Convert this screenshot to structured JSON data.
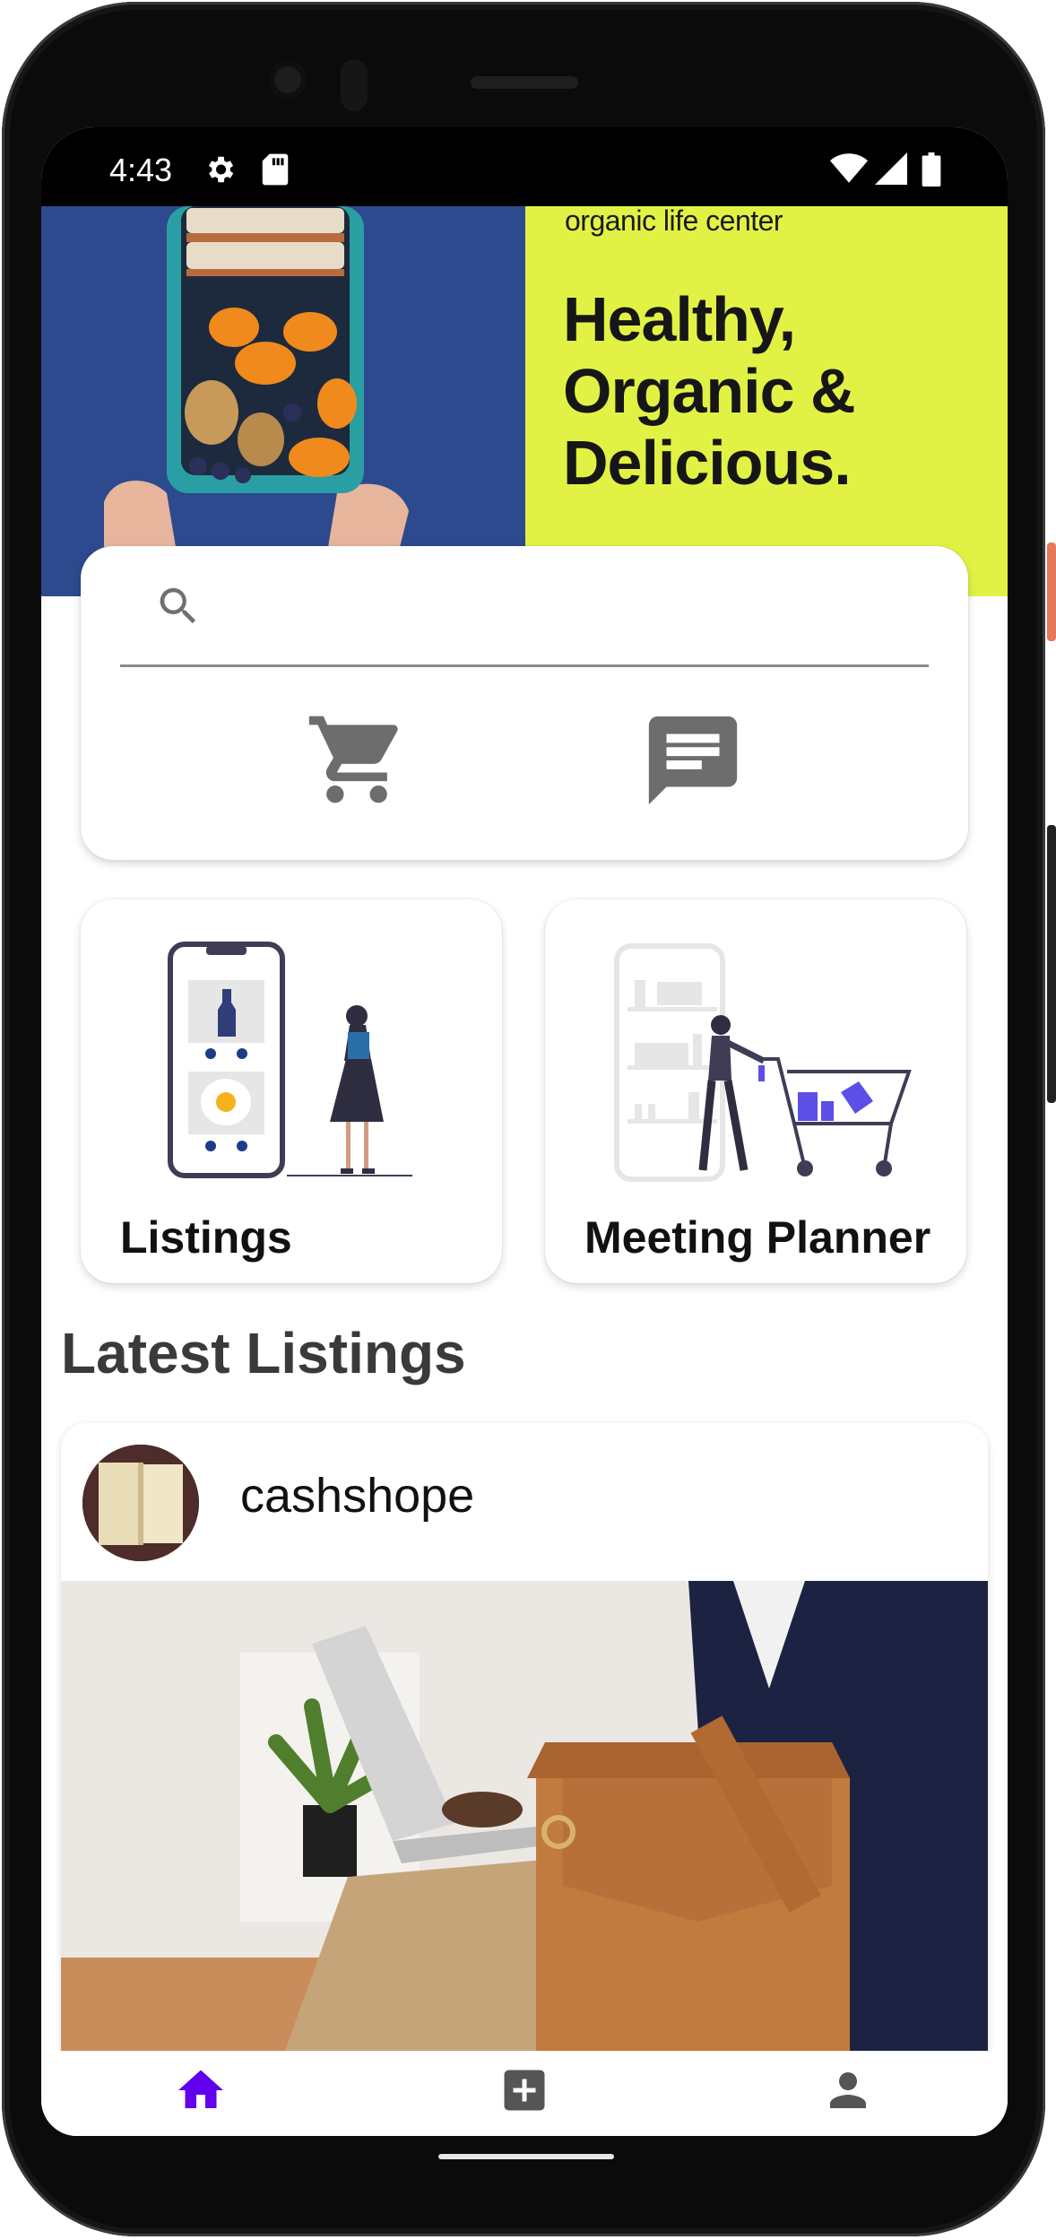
{
  "status_bar": {
    "time": "4:43",
    "icons": [
      "gear-icon",
      "sd-card-icon",
      "wifi-icon",
      "signal-icon",
      "battery-icon"
    ]
  },
  "banner": {
    "tagline": "organic life center",
    "headline": "Healthy, Organic & Delicious.",
    "colors": {
      "left": "#2d4a8f",
      "right": "#e2f245"
    }
  },
  "search": {
    "placeholder": "",
    "value": ""
  },
  "quick_actions": [
    "cart-icon",
    "message-icon"
  ],
  "tiles": [
    {
      "label": "Listings",
      "icon": "listings-illustration"
    },
    {
      "label": "Meeting Planner",
      "icon": "shopping-cart-illustration"
    }
  ],
  "latest": {
    "title": "Latest Listings",
    "items": [
      {
        "username": "cashshope",
        "avatar": "book-avatar",
        "image": "man-with-laptop-and-briefcase"
      }
    ]
  },
  "bottom_nav": {
    "items": [
      "home-icon",
      "add-box-icon",
      "person-icon"
    ],
    "active": "home-icon",
    "accent": "#6200ee"
  }
}
